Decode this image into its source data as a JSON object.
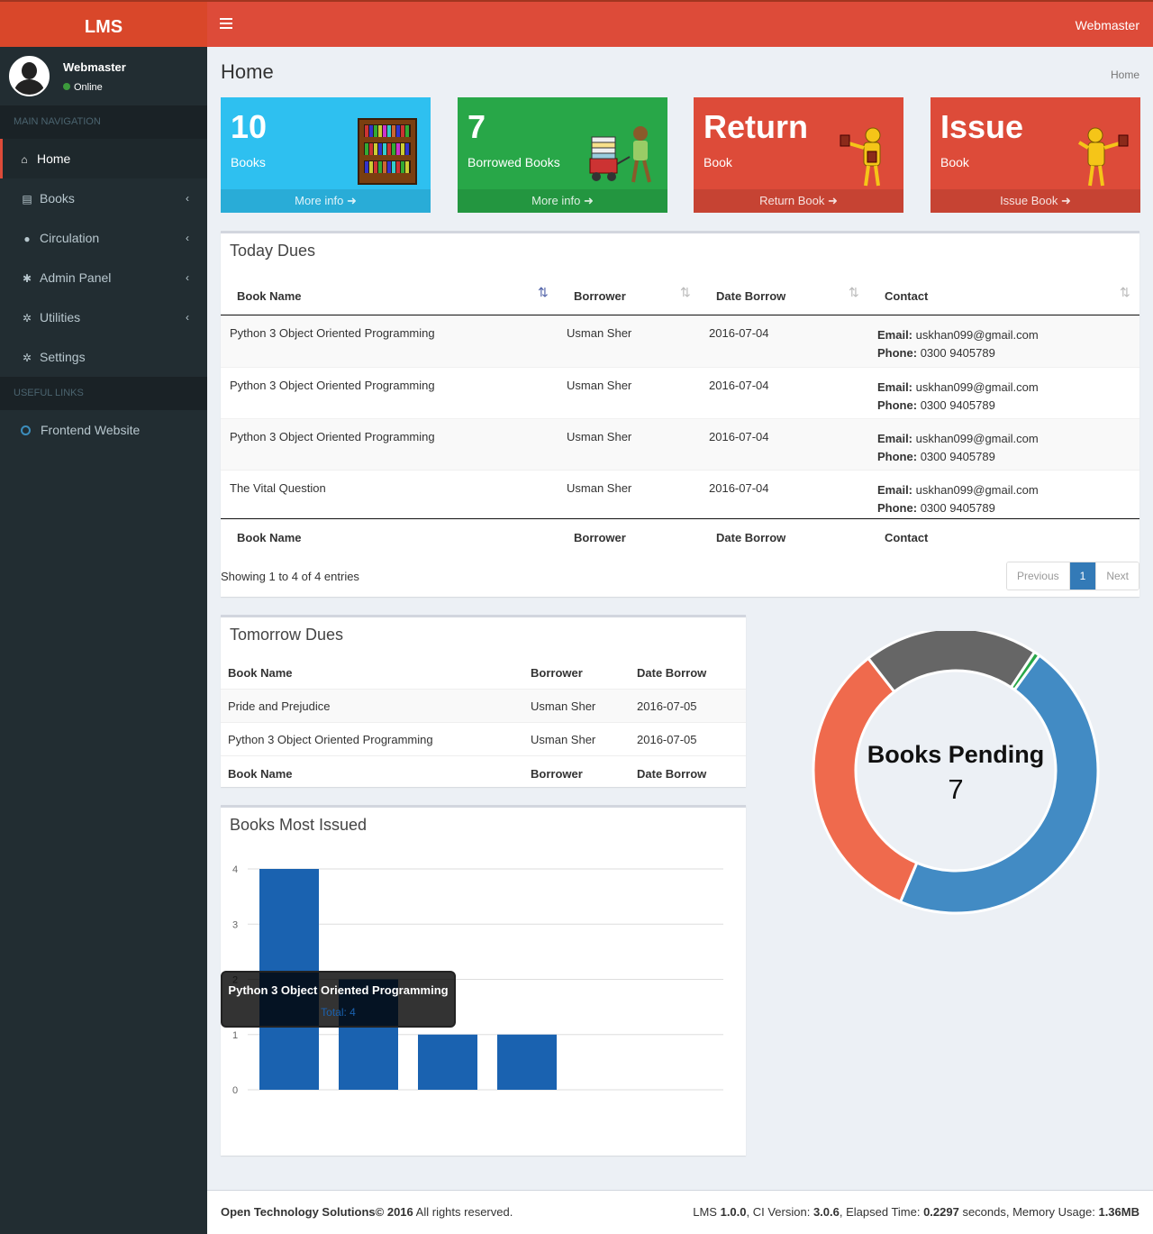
{
  "app": {
    "logo": "LMS",
    "top_user": "Webmaster"
  },
  "user": {
    "name": "Webmaster",
    "status": "Online"
  },
  "sidebar": {
    "main_header": "MAIN NAVIGATION",
    "items": [
      {
        "label": "Home",
        "icon": "home-icon"
      },
      {
        "label": "Books",
        "icon": "book-icon"
      },
      {
        "label": "Circulation",
        "icon": "user-icon"
      },
      {
        "label": "Admin Panel",
        "icon": "gear-icon"
      },
      {
        "label": "Utilities",
        "icon": "gears-icon"
      },
      {
        "label": "Settings",
        "icon": "gears-icon"
      }
    ],
    "links_header": "USEFUL LINKS",
    "links": [
      {
        "label": "Frontend Website",
        "icon": "circle-icon"
      }
    ]
  },
  "page": {
    "title": "Home",
    "breadcrumb": "Home"
  },
  "cards": [
    {
      "number": "10",
      "label": "Books",
      "footer": "More info",
      "color": "#2ec0f0"
    },
    {
      "number": "7",
      "label": "Borrowed Books",
      "footer": "More info",
      "color": "#28a748"
    },
    {
      "number": "Return",
      "label": "Book",
      "footer": "Return Book",
      "color": "#dd4b39"
    },
    {
      "number": "Issue",
      "label": "Book",
      "footer": "Issue Book",
      "color": "#dd4b39"
    }
  ],
  "today_dues": {
    "title": "Today Dues",
    "columns": [
      "Book Name",
      "Borrower",
      "Date Borrow",
      "Contact"
    ],
    "email_label": "Email:",
    "phone_label": "Phone:",
    "rows": [
      {
        "book": "Python 3 Object Oriented Programming",
        "borrower": "Usman Sher",
        "date": "2016-07-04",
        "email": "uskhan099@gmail.com",
        "phone": "0300 9405789"
      },
      {
        "book": "Python 3 Object Oriented Programming",
        "borrower": "Usman Sher",
        "date": "2016-07-04",
        "email": "uskhan099@gmail.com",
        "phone": "0300 9405789"
      },
      {
        "book": "Python 3 Object Oriented Programming",
        "borrower": "Usman Sher",
        "date": "2016-07-04",
        "email": "uskhan099@gmail.com",
        "phone": "0300 9405789"
      },
      {
        "book": "The Vital Question",
        "borrower": "Usman Sher",
        "date": "2016-07-04",
        "email": "uskhan099@gmail.com",
        "phone": "0300 9405789"
      }
    ],
    "info": "Showing 1 to 4 of 4 entries",
    "pager": {
      "prev": "Previous",
      "current": "1",
      "next": "Next"
    }
  },
  "tomorrow_dues": {
    "title": "Tomorrow Dues",
    "columns": [
      "Book Name",
      "Borrower",
      "Date Borrow"
    ],
    "rows": [
      {
        "book": "Pride and Prejudice",
        "borrower": "Usman Sher",
        "date": "2016-07-05"
      },
      {
        "book": "Python 3 Object Oriented Programming",
        "borrower": "Usman Sher",
        "date": "2016-07-05"
      }
    ]
  },
  "most_issued": {
    "title": "Books Most Issued",
    "tooltip": {
      "title": "Python 3 Object Oriented Programming",
      "value": "Total: 4"
    }
  },
  "donut": {
    "label": "Books Pending",
    "value": "7"
  },
  "chart_data": [
    {
      "type": "bar",
      "title": "Books Most Issued",
      "categories": [
        "",
        "",
        "",
        ""
      ],
      "values": [
        4,
        2,
        1,
        1
      ],
      "ylim": [
        0,
        4
      ],
      "yticks": [
        0,
        1,
        2,
        3,
        4
      ],
      "color": "#1a62b0",
      "grid": true
    },
    {
      "type": "pie",
      "values": [
        7,
        5,
        3,
        0.1
      ],
      "colors": [
        "#428bc4",
        "#ef6a4d",
        "#666666",
        "#28a748"
      ],
      "center_text": "Books Pending 7"
    }
  ],
  "footer": {
    "company": "Open Technology Solutions",
    "year": "© 2016",
    "rights": " All rights reserved.",
    "version_label": "LMS ",
    "version": "1.0.0",
    "ci_label": ", CI Version: ",
    "ci": "3.0.6",
    "elapsed_label": ", Elapsed Time: ",
    "elapsed": "0.2297",
    "mem_label": " seconds, Memory Usage: ",
    "mem": "1.36MB"
  }
}
